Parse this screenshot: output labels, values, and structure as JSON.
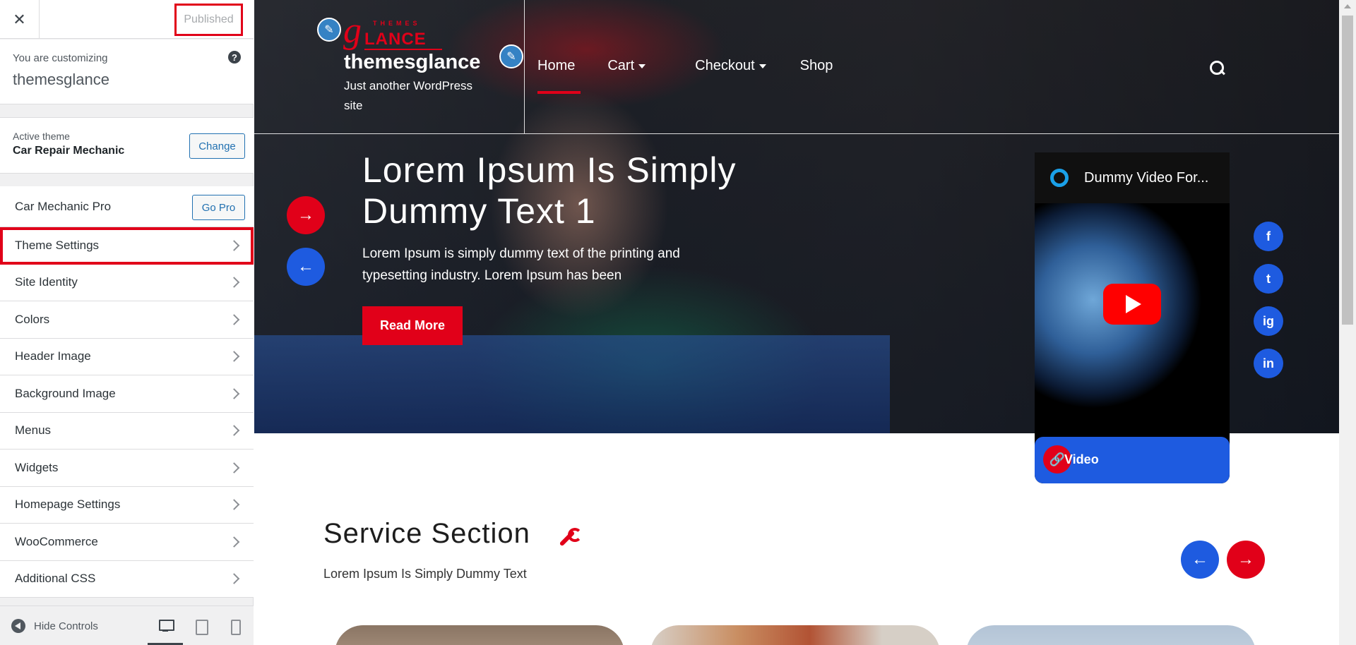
{
  "sidebar": {
    "close_icon": "close-icon",
    "publish_label": "Published",
    "customizing_label": "You are customizing",
    "site_name": "themesglance",
    "help_icon": "?",
    "active_theme_label": "Active theme",
    "active_theme_name": "Car Repair Mechanic",
    "change_label": "Change",
    "go_pro_row": {
      "label": "Car Mechanic Pro",
      "button": "Go Pro"
    },
    "items": [
      {
        "label": "Theme Settings"
      },
      {
        "label": "Site Identity"
      },
      {
        "label": "Colors"
      },
      {
        "label": "Header Image"
      },
      {
        "label": "Background Image"
      },
      {
        "label": "Menus"
      },
      {
        "label": "Widgets"
      },
      {
        "label": "Homepage Settings"
      },
      {
        "label": "WooCommerce"
      },
      {
        "label": "Additional CSS"
      }
    ],
    "footer": {
      "hide_controls": "Hide Controls"
    }
  },
  "preview": {
    "logo": {
      "g": "g",
      "themes": "THEMES",
      "lance": "LANCE"
    },
    "site_title": "themesglance",
    "tagline": "Just another WordPress site",
    "nav": [
      {
        "label": "Home",
        "active": true
      },
      {
        "label": "Cart",
        "has_dropdown": true
      },
      {
        "label": "Checkout",
        "has_dropdown": true
      },
      {
        "label": "Shop"
      }
    ],
    "slide": {
      "title": "Lorem Ipsum Is Simply Dummy Text 1",
      "text": "Lorem Ipsum is simply dummy text of the printing and typesetting industry. Lorem Ipsum has been",
      "button": "Read More"
    },
    "video": {
      "title": "Dummy Video For...",
      "label": "Video"
    },
    "social": [
      "f",
      "t",
      "ig",
      "in"
    ],
    "service": {
      "title": "Service Section",
      "subtitle": "Lorem Ipsum Is Simply Dummy Text"
    },
    "arrows": {
      "next": "→",
      "prev": "←"
    },
    "pencil": "✎",
    "link_glyph": "🔗"
  },
  "colors": {
    "accent_red": "#e10019",
    "accent_blue": "#1e5be0",
    "wp_blue": "#2271b1"
  }
}
